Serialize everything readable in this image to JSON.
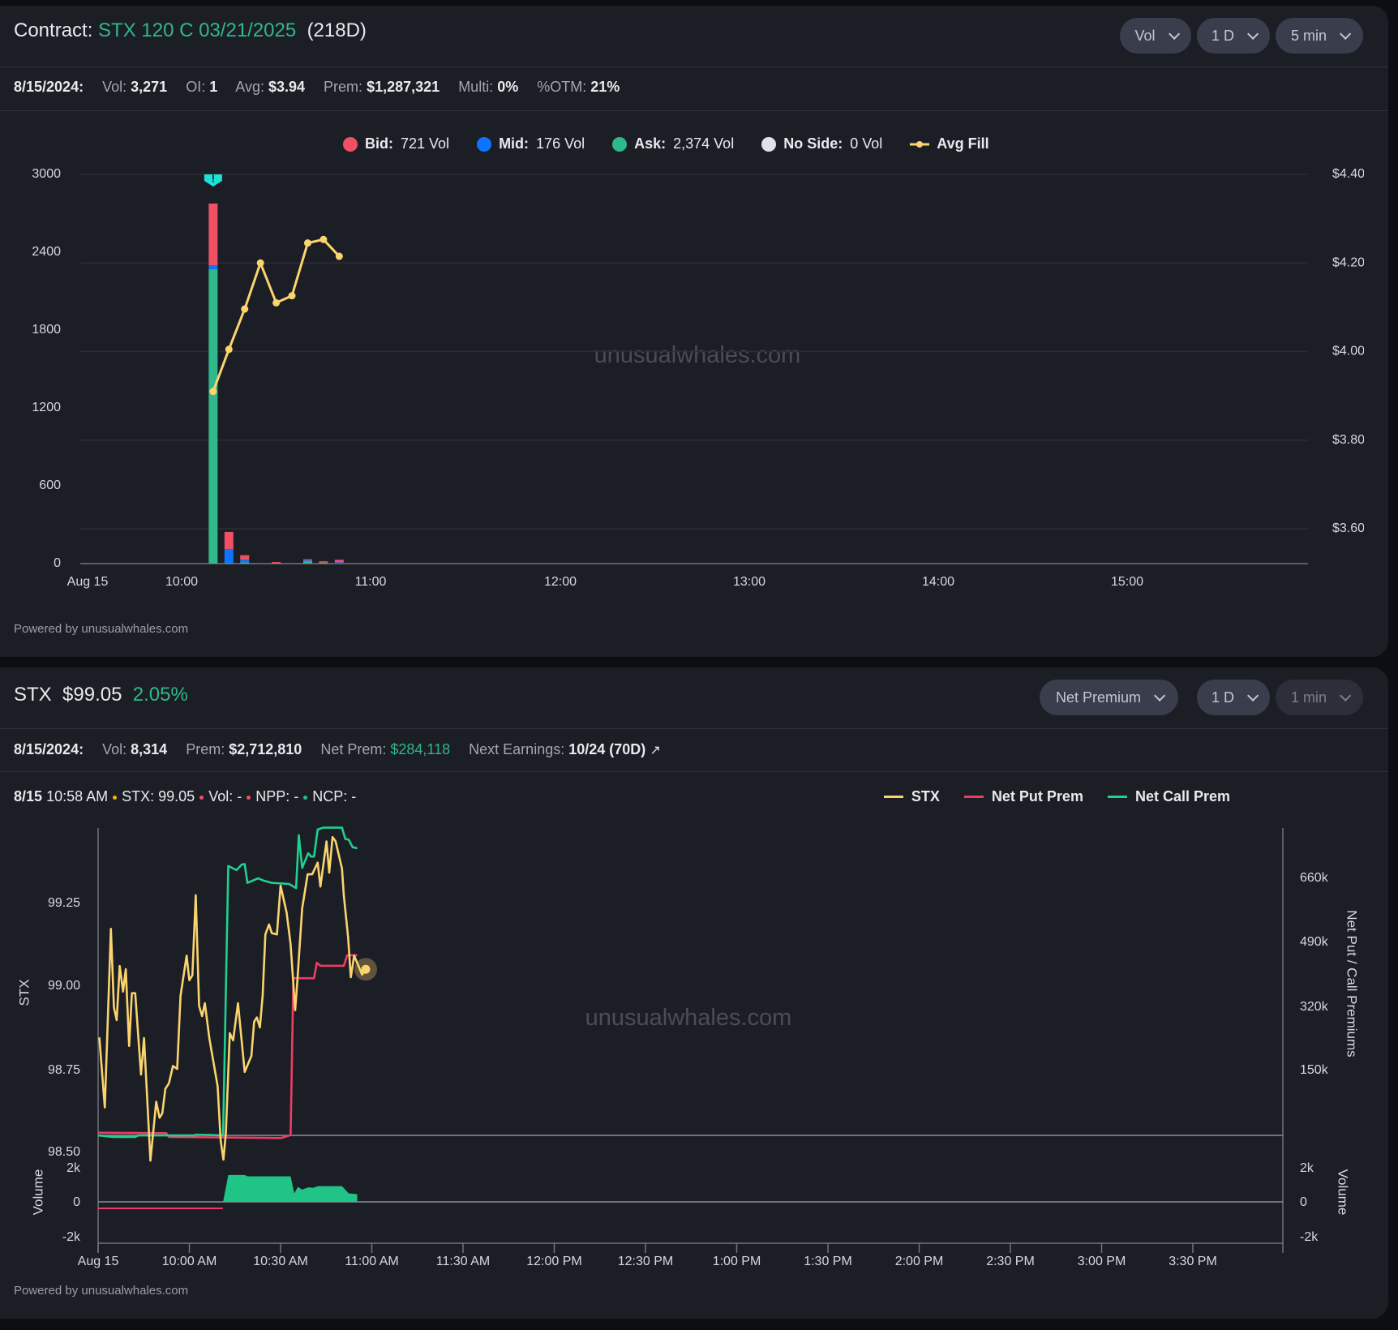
{
  "colors": {
    "bid": "#ef5064",
    "mid": "#0c74ff",
    "ask": "#2fb88a",
    "noside": "#dfe2e8",
    "avg": "#fbd46d",
    "stx": "#fbd46d",
    "put": "#ee3d63",
    "call": "#1fd18e",
    "volume": "#1fc486"
  },
  "contract": {
    "title_label": "Contract:",
    "contract_name": "STX 120 C 03/21/2025",
    "days": "(218D)",
    "controls": {
      "metric": "Vol",
      "range": "1 D",
      "interval": "5 min"
    },
    "stats": {
      "date": "8/15/2024:",
      "vol_label": "Vol:",
      "vol": "3,271",
      "oi_label": "OI:",
      "oi": "1",
      "avg_label": "Avg:",
      "avg": "$3.94",
      "prem_label": "Prem:",
      "prem": "$1,287,321",
      "multi_label": "Multi:",
      "multi": "0%",
      "otm_label": "%OTM:",
      "otm": "21%"
    },
    "legend": [
      {
        "name": "Bid:",
        "value": "721 Vol"
      },
      {
        "name": "Mid:",
        "value": "176 Vol"
      },
      {
        "name": "Ask:",
        "value": "2,374 Vol"
      },
      {
        "name": "No Side:",
        "value": "0 Vol"
      },
      {
        "name": "Avg Fill",
        "value": ""
      }
    ],
    "watermark": "unusualwhales.com",
    "powered": "Powered by unusualwhales.com",
    "alert_icon": "exclamation-badge-icon"
  },
  "stock": {
    "ticker": "STX",
    "price": "$99.05",
    "change": "2.05%",
    "controls": {
      "metric": "Net Premium",
      "range": "1 D",
      "interval": "1 min"
    },
    "stats": {
      "date": "8/15/2024:",
      "vol_label": "Vol:",
      "vol": "8,314",
      "prem_label": "Prem:",
      "prem": "$2,712,810",
      "net_label": "Net Prem:",
      "net": "$284,118",
      "earn_label": "Next Earnings:",
      "earn": "10/24 (70D)"
    },
    "info": {
      "date": "8/15",
      "time": "10:58 AM",
      "stx": "STX: 99.05",
      "vol": "Vol: -",
      "npp": "NPP: -",
      "ncp": "NCP: -"
    },
    "legend": [
      "STX",
      "Net Put Prem",
      "Net Call Prem"
    ],
    "watermark": "unusualwhales.com",
    "powered": "Powered by unusualwhales.com"
  },
  "chart_data": [
    {
      "type": "bar",
      "title": "Contract volume by side with average fill",
      "x_ticks": [
        "Aug 15",
        "10:00",
        "11:00",
        "12:00",
        "13:00",
        "14:00",
        "15:00"
      ],
      "y_left_ticks": [
        "3000",
        "2400",
        "1800",
        "1200",
        "600",
        "0"
      ],
      "y_left_range": [
        0,
        3000
      ],
      "y_right_ticks": [
        "$4.40",
        "$4.20",
        "$4.00",
        "$3.80",
        "$3.60"
      ],
      "y_right_range": [
        3.6,
        4.4
      ],
      "bars": [
        {
          "time": "10:10",
          "ask": 2270,
          "mid": 30,
          "bid": 475
        },
        {
          "time": "10:15",
          "ask": 5,
          "mid": 107,
          "bid": 132
        },
        {
          "time": "10:20",
          "ask": 10,
          "mid": 20,
          "bid": 35
        },
        {
          "time": "10:30",
          "ask": 0,
          "mid": 0,
          "bid": 12
        },
        {
          "time": "10:40",
          "ask": 20,
          "mid": 5,
          "bid": 8
        },
        {
          "time": "10:45",
          "ask": 8,
          "mid": 0,
          "bid": 10
        },
        {
          "time": "10:50",
          "ask": 0,
          "mid": 10,
          "bid": 20
        }
      ],
      "avg_fill": [
        {
          "time": "10:10",
          "value": 3.91
        },
        {
          "time": "10:15",
          "value": 4.005
        },
        {
          "time": "10:20",
          "value": 4.096
        },
        {
          "time": "10:25",
          "value": 4.2
        },
        {
          "time": "10:30",
          "value": 4.11
        },
        {
          "time": "10:35",
          "value": 4.126
        },
        {
          "time": "10:40",
          "value": 4.245
        },
        {
          "time": "10:45",
          "value": 4.253
        },
        {
          "time": "10:50",
          "value": 4.215
        }
      ],
      "alert_time": "10:10"
    },
    {
      "type": "line",
      "title": "STX price, net put/call premium and volume",
      "x_unit": "minutes since 9:30 AM",
      "x_ticks": [
        "Aug 15",
        "10:00 AM",
        "10:30 AM",
        "11:00 AM",
        "11:30 AM",
        "12:00 PM",
        "12:30 PM",
        "1:00 PM",
        "1:30 PM",
        "2:00 PM",
        "2:30 PM",
        "3:00 PM",
        "3:30 PM"
      ],
      "y_left_label": "STX",
      "y_left_ticks": [
        "99.25",
        "99.00",
        "98.75",
        "98.50"
      ],
      "y_right_label": "Net Put / Call Premiums",
      "y_right_ticks": [
        "660k",
        "490k",
        "320k",
        "150k"
      ],
      "volume_label": "Volume",
      "volume_ticks": [
        "2k",
        "0",
        "-2k"
      ],
      "stx": [
        [
          0.4,
          98.845
        ],
        [
          2.2,
          98.634
        ],
        [
          4.2,
          99.172
        ],
        [
          5.2,
          98.935
        ],
        [
          6.1,
          98.897
        ],
        [
          7.1,
          99.06
        ],
        [
          8.2,
          98.983
        ],
        [
          9.1,
          99.05
        ],
        [
          10.2,
          98.819
        ],
        [
          11.1,
          98.978
        ],
        [
          12.2,
          98.978
        ],
        [
          14.1,
          98.733
        ],
        [
          15.1,
          98.843
        ],
        [
          17.2,
          98.474
        ],
        [
          19.1,
          98.651
        ],
        [
          20.2,
          98.603
        ],
        [
          21.1,
          98.616
        ],
        [
          22.1,
          98.69
        ],
        [
          23.3,
          98.707
        ],
        [
          24.6,
          98.759
        ],
        [
          26,
          98.75
        ],
        [
          27.1,
          98.97
        ],
        [
          29.1,
          99.091
        ],
        [
          30,
          99.017
        ],
        [
          31,
          99.032
        ],
        [
          32.1,
          99.273
        ],
        [
          33.2,
          98.94
        ],
        [
          34.2,
          98.909
        ],
        [
          35.1,
          98.948
        ],
        [
          36.6,
          98.841
        ],
        [
          39.3,
          98.698
        ],
        [
          40.3,
          98.535
        ],
        [
          41.2,
          98.477
        ],
        [
          42,
          98.556
        ],
        [
          43.3,
          98.858
        ],
        [
          44.4,
          98.836
        ],
        [
          46,
          98.948
        ],
        [
          48.2,
          98.741
        ],
        [
          50.4,
          98.789
        ],
        [
          51.3,
          98.892
        ],
        [
          52.2,
          98.905
        ],
        [
          53.2,
          98.875
        ],
        [
          54.1,
          98.97
        ],
        [
          55,
          99.155
        ],
        [
          56.2,
          99.185
        ],
        [
          57.1,
          99.159
        ],
        [
          58.8,
          99.155
        ],
        [
          60,
          99.302
        ],
        [
          62,
          99.22
        ],
        [
          63.3,
          99.125
        ],
        [
          64.8,
          98.927
        ],
        [
          65.5,
          99.013
        ],
        [
          67.1,
          99.233
        ],
        [
          68.9,
          99.336
        ],
        [
          70.4,
          99.336
        ],
        [
          72.2,
          99.371
        ],
        [
          73.1,
          99.299
        ],
        [
          75.1,
          99.435
        ],
        [
          76,
          99.341
        ],
        [
          77.1,
          99.448
        ],
        [
          78.1,
          99.435
        ],
        [
          80.2,
          99.353
        ],
        [
          80.8,
          99.272
        ],
        [
          82.2,
          99.147
        ],
        [
          83.1,
          99.026
        ],
        [
          84.2,
          99.091
        ],
        [
          86.8,
          99.034
        ],
        [
          88,
          99.05
        ]
      ],
      "net_call_prem_k": [
        [
          0,
          -23
        ],
        [
          5.1,
          -27
        ],
        [
          12.2,
          -27
        ],
        [
          13.2,
          -23
        ],
        [
          31.7,
          -23
        ],
        [
          32.2,
          -21
        ],
        [
          41.1,
          -23
        ],
        [
          42.8,
          695
        ],
        [
          45.5,
          684
        ],
        [
          47.3,
          699
        ],
        [
          48.2,
          700
        ],
        [
          49.1,
          650
        ],
        [
          52.6,
          662
        ],
        [
          54.4,
          656
        ],
        [
          57.1,
          650
        ],
        [
          62.8,
          647
        ],
        [
          65.1,
          636
        ],
        [
          66,
          777
        ],
        [
          67.1,
          690
        ],
        [
          69.1,
          729
        ],
        [
          70,
          720
        ],
        [
          71,
          720
        ],
        [
          72.2,
          792
        ],
        [
          74,
          797
        ],
        [
          80.2,
          797
        ],
        [
          81.3,
          767
        ],
        [
          82.4,
          765
        ],
        [
          83.7,
          745
        ],
        [
          85.2,
          742
        ]
      ],
      "net_put_prem_k": [
        [
          0,
          -16
        ],
        [
          22.4,
          -17
        ],
        [
          23.3,
          -27
        ],
        [
          60.2,
          -30
        ],
        [
          63.3,
          -22
        ],
        [
          64.2,
          396
        ],
        [
          71,
          396
        ],
        [
          71.9,
          437
        ],
        [
          73.1,
          429
        ],
        [
          80.8,
          429
        ],
        [
          81.9,
          457
        ],
        [
          85.2,
          457
        ]
      ],
      "volume": [
        [
          0,
          0
        ],
        [
          41.1,
          0
        ],
        [
          42.8,
          1580
        ],
        [
          48.2,
          1580
        ],
        [
          49.1,
          1500
        ],
        [
          63.3,
          1500
        ],
        [
          64.5,
          500
        ],
        [
          65.7,
          880
        ],
        [
          67.1,
          720
        ],
        [
          69.1,
          850
        ],
        [
          70.8,
          830
        ],
        [
          72.2,
          920
        ],
        [
          80.2,
          920
        ],
        [
          82.4,
          500
        ],
        [
          85.2,
          450
        ]
      ]
    }
  ]
}
